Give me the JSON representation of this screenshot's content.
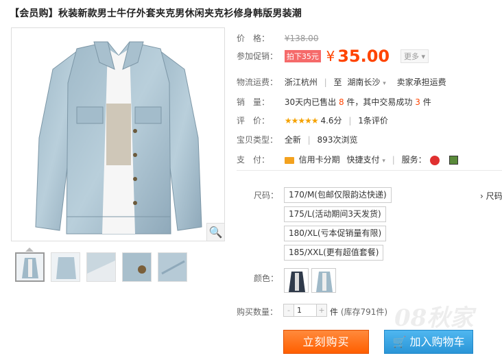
{
  "title": "【会员购】秋装新款男士牛仔外套夹克男休闲夹克衫修身韩版男装潮",
  "price": {
    "label": "价　格：",
    "original": "¥138.00"
  },
  "promo": {
    "label": "参加促销：",
    "tag": "拍下35元",
    "currency": "¥",
    "price": "35.00",
    "more": "更多 ▾"
  },
  "shipping": {
    "label": "物流运费：",
    "from": "浙江杭州",
    "to_prefix": "至",
    "to": "湖南长沙",
    "caret": "▾",
    "note": "卖家承担运费"
  },
  "sales": {
    "label": "销　量：",
    "text1": "30天内已售出",
    "sold": "8",
    "text2": "件，其中交易成功",
    "success": "3",
    "text3": "件"
  },
  "rating": {
    "label": "评　价：",
    "stars": "★★★★★",
    "score": "4.6分",
    "reviews": "1条评价"
  },
  "item_type": {
    "label": "宝贝类型：",
    "condition": "全新",
    "views": "893次浏览"
  },
  "payment": {
    "label": "支　付：",
    "credit": "信用卡分期",
    "quick": "快捷支付",
    "caret": "▾",
    "service_label": "服务："
  },
  "size": {
    "label": "尺码：",
    "options": [
      "170/M(包邮仅限韵达快递)",
      "175/L(活动期间3天发货)",
      "180/XL(亏本促销量有限)",
      "185/XXL(更有超值套餐)"
    ],
    "right_label": "› 尺码"
  },
  "color": {
    "label": "颜色："
  },
  "quantity": {
    "label": "购买数量：",
    "minus": "-",
    "value": "1",
    "plus": "+",
    "unit": "件",
    "stock": "(库存791件)"
  },
  "buttons": {
    "buy": "立刻购买",
    "cart": "加入购物车"
  },
  "watermark": "08秋家"
}
